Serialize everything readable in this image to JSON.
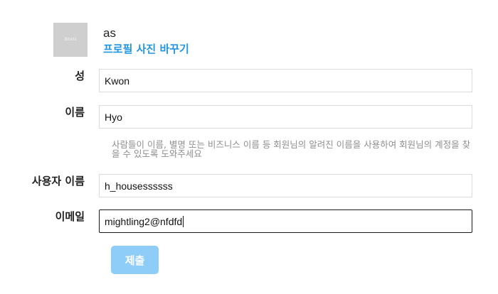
{
  "profile": {
    "avatar_text": "Blbills",
    "username": "as",
    "change_photo_label": "프로필 사진 바꾸기"
  },
  "form": {
    "last_name": {
      "label": "성",
      "value": "Kwon"
    },
    "first_name": {
      "label": "이름",
      "value": "Hyo"
    },
    "name_helper": "사람들이 이름, 별명 또는 비즈니스 이름 등 회원님의 알려진 이름을 사용하여 회원님의 계정을 찾을 수 있도록 도와주세요",
    "username": {
      "label": "사용자 이름",
      "value": "h_housessssss"
    },
    "email": {
      "label": "이메일",
      "value": "mightling2@nfdfd"
    },
    "submit_label": "제출"
  },
  "colors": {
    "link": "#2196e3",
    "submit_disabled": "#8ecdf8",
    "helper_text": "#8e8e8e",
    "field_border": "#dbdbdb"
  }
}
